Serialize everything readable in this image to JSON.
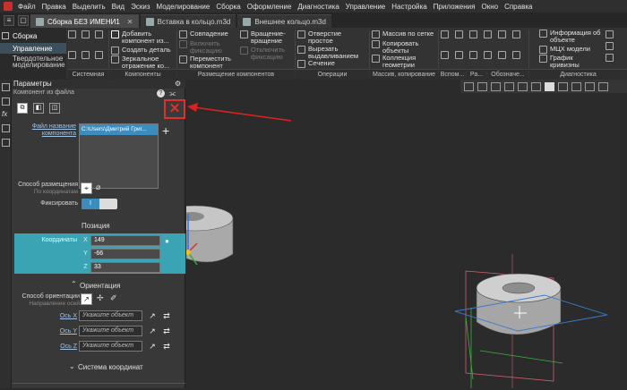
{
  "menu": [
    "Файл",
    "Правка",
    "Выделить",
    "Вид",
    "Эскиз",
    "Моделирование",
    "Сборка",
    "Оформление",
    "Диагностика",
    "Управление",
    "Настройка",
    "Приложения",
    "Окно",
    "Справка"
  ],
  "tabs": [
    {
      "label": "Сборка БЕЗ ИМЕНИ1",
      "active": true
    },
    {
      "label": "Вставка в кольцо.m3d",
      "active": false
    },
    {
      "label": "Внешнее кольцо.m3d",
      "active": false
    }
  ],
  "ribbon": {
    "mode": "Сборка",
    "side_items": [
      "Управление",
      "Твердотельное моделирование"
    ],
    "add_component": "Добавить компонент из...",
    "create_part": "Создать деталь",
    "mirror": "Зеркальное отражение ко...",
    "coincidence": "Совпадение",
    "enable_fix": "Включить фиксацию",
    "disable_fix": "Отключить фиксацию",
    "move_component": "Переместить компонент",
    "rotation": "Вращение-вращение",
    "hole": "Отверстие простое",
    "cut_extrude": "Вырезать выдавливанием",
    "section": "Сечение",
    "array_grid": "Массив по сетке",
    "copy_objects": "Копировать объекты",
    "geom_collection": "Коллекция геометрии",
    "info_object": "Информация об объекте",
    "mcx_model": "МЦХ модели",
    "curvature": "График кривизны",
    "groups": [
      "Системная",
      "Компоненты",
      "Размещение компонентов",
      "Операции",
      "Массив, копирование",
      "Вспом...",
      "Ра...",
      "Обозначе...",
      "Диагностика"
    ]
  },
  "panel": {
    "title": "Параметры",
    "subtitle": "Компонент из файла",
    "file_name_label": "Файл название компонента",
    "file_path": "C:\\Users\\Дмитрий Григ...",
    "placement_label": "Способ размещения",
    "placement_sub": "По координатам",
    "fix_label": "Фиксировать",
    "fix_value": "I",
    "position_header": "Позиция",
    "coords_label": "Координаты",
    "coords": [
      {
        "axis": "X",
        "value": "149"
      },
      {
        "axis": "Y",
        "value": "-66"
      },
      {
        "axis": "Z",
        "value": "33"
      }
    ],
    "orientation_header": "Ориентация",
    "orient_label": "Способ ориентации",
    "orient_sub": "Направление осей",
    "axes": [
      {
        "label": "Ось X",
        "placeholder": "Укажите объект"
      },
      {
        "label": "Ось Y",
        "placeholder": "Укажите объект"
      },
      {
        "label": "Ось Z",
        "placeholder": "Укажите объект"
      }
    ],
    "coord_system_header": "Система координат"
  },
  "colors": {
    "accent": "#3c8dbe",
    "close": "#e0302c",
    "highlight_band": "#3aa4b4"
  }
}
